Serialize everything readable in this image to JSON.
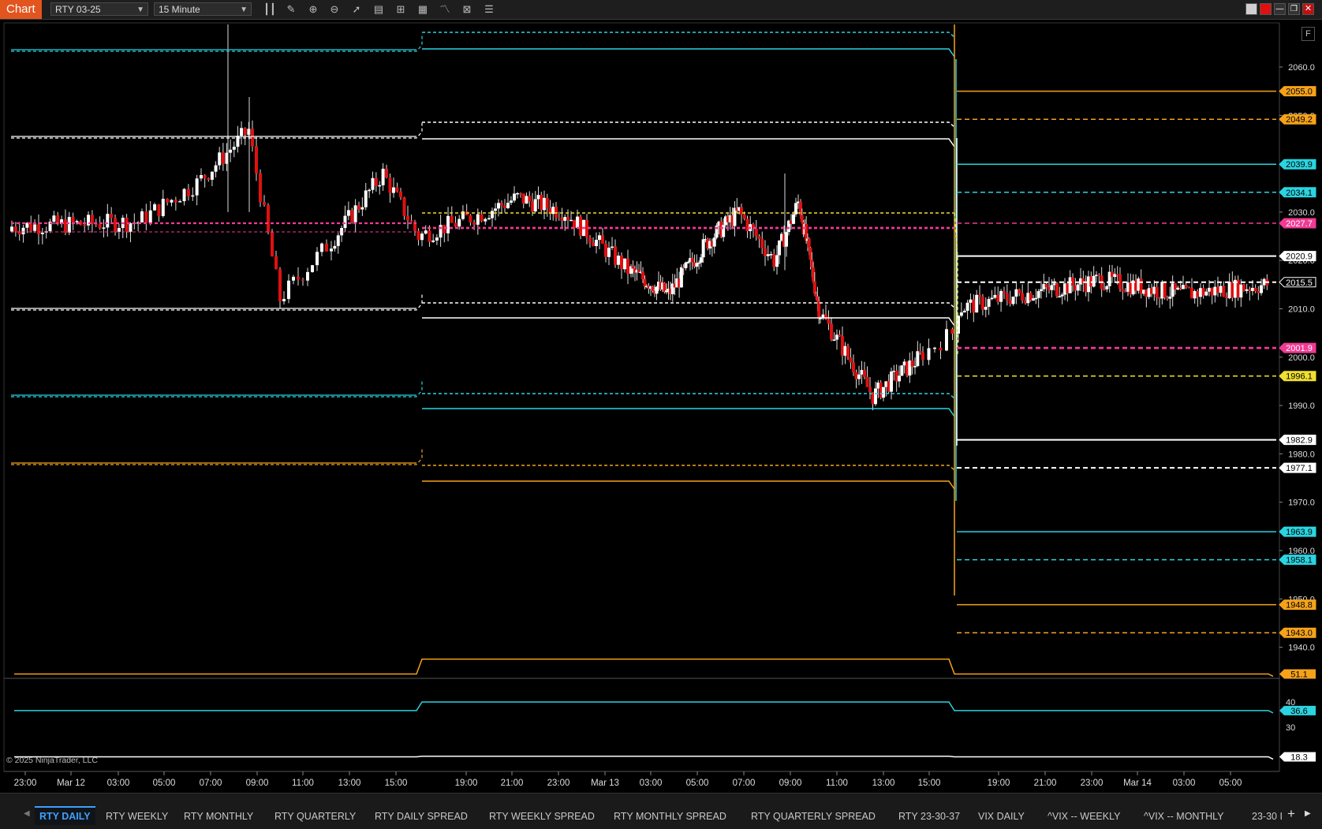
{
  "toolbar": {
    "app_label": "Chart",
    "instrument": "RTY 03-25",
    "interval": "15 Minute",
    "icons": [
      "bars-icon",
      "pencil-icon",
      "zoom-in-icon",
      "zoom-out-icon",
      "pointer-icon",
      "properties-icon",
      "data-box-icon",
      "strategy-icon",
      "indicators-icon",
      "templates-icon",
      "list-icon"
    ]
  },
  "copyright": "© 2025 NinjaTrader, LLC",
  "panel_button": "F",
  "colors": {
    "cyan": "#2ad4e0",
    "white": "#ffffff",
    "orange": "#f5a21a",
    "yellow": "#f0e030",
    "magenta": "#f03a94",
    "up": "#ffffff",
    "down": "#e01010"
  },
  "price_axis": {
    "range": [
      1930,
      2066
    ],
    "ticks": [
      "2060.0",
      "2050.0",
      "2040.0",
      "2030.0",
      "2020.0",
      "2010.0",
      "2000.0",
      "1990.0",
      "1980.0",
      "1970.0",
      "1960.0",
      "1950.0",
      "1940.0"
    ],
    "badges": [
      {
        "value": 2055.0,
        "label": "2055.0",
        "color": "#f5a21a",
        "text": "#000"
      },
      {
        "value": 2049.2,
        "label": "2049.2",
        "color": "#f5a21a",
        "text": "#000"
      },
      {
        "value": 2039.9,
        "label": "2039.9",
        "color": "#2ad4e0",
        "text": "#000"
      },
      {
        "value": 2034.1,
        "label": "2034.1",
        "color": "#2ad4e0",
        "text": "#000"
      },
      {
        "value": 2027.7,
        "label": "2027.7",
        "color": "#f03a94",
        "text": "#fff"
      },
      {
        "value": 2020.9,
        "label": "2020.9",
        "color": "#ffffff",
        "text": "#000"
      },
      {
        "value": 2015.5,
        "label": "2015.5",
        "color": "#000000",
        "text": "#fff"
      },
      {
        "value": 2001.9,
        "label": "2001.9",
        "color": "#f03a94",
        "text": "#fff"
      },
      {
        "value": 1996.1,
        "label": "1996.1",
        "color": "#f0e030",
        "text": "#000"
      },
      {
        "value": 1982.9,
        "label": "1982.9",
        "color": "#ffffff",
        "text": "#000"
      },
      {
        "value": 1977.1,
        "label": "1977.1",
        "color": "#ffffff",
        "text": "#000"
      },
      {
        "value": 1963.9,
        "label": "1963.9",
        "color": "#2ad4e0",
        "text": "#000"
      },
      {
        "value": 1958.1,
        "label": "1958.1",
        "color": "#2ad4e0",
        "text": "#000"
      },
      {
        "value": 1948.8,
        "label": "1948.8",
        "color": "#f5a21a",
        "text": "#000"
      },
      {
        "value": 1943.0,
        "label": "1943.0",
        "color": "#f5a21a",
        "text": "#000"
      }
    ]
  },
  "indicator_axis": {
    "ticks": [
      "40",
      "30"
    ],
    "badges": [
      {
        "value": 51.1,
        "label": "51.1",
        "color": "#f5a21a",
        "text": "#000"
      },
      {
        "value": 36.6,
        "label": "36.6",
        "color": "#2ad4e0",
        "text": "#000"
      },
      {
        "value": 18.3,
        "label": "18.3",
        "color": "#ffffff",
        "text": "#000"
      }
    ]
  },
  "time_axis": [
    "23:00",
    "Mar 12",
    "03:00",
    "05:00",
    "07:00",
    "09:00",
    "11:00",
    "13:00",
    "15:00",
    "19:00",
    "21:00",
    "23:00",
    "Mar 13",
    "03:00",
    "05:00",
    "07:00",
    "09:00",
    "11:00",
    "13:00",
    "15:00",
    "19:00",
    "21:00",
    "23:00",
    "Mar 14",
    "03:00",
    "05:00"
  ],
  "tabs": [
    "RTY DAILY",
    "RTY WEEKLY",
    "RTY MONTHLY",
    "RTY QUARTERLY",
    "RTY DAILY SPREAD",
    "RTY WEEKLY SPREAD",
    "RTY MONTHLY SPREAD",
    "RTY QUARTERLY SPREAD",
    "RTY 23-30-37",
    "VIX DAILY",
    "^VIX -- WEEKLY",
    "^VIX -- MONTHLY",
    "23-30 I"
  ],
  "active_tab": "RTY DAILY"
}
